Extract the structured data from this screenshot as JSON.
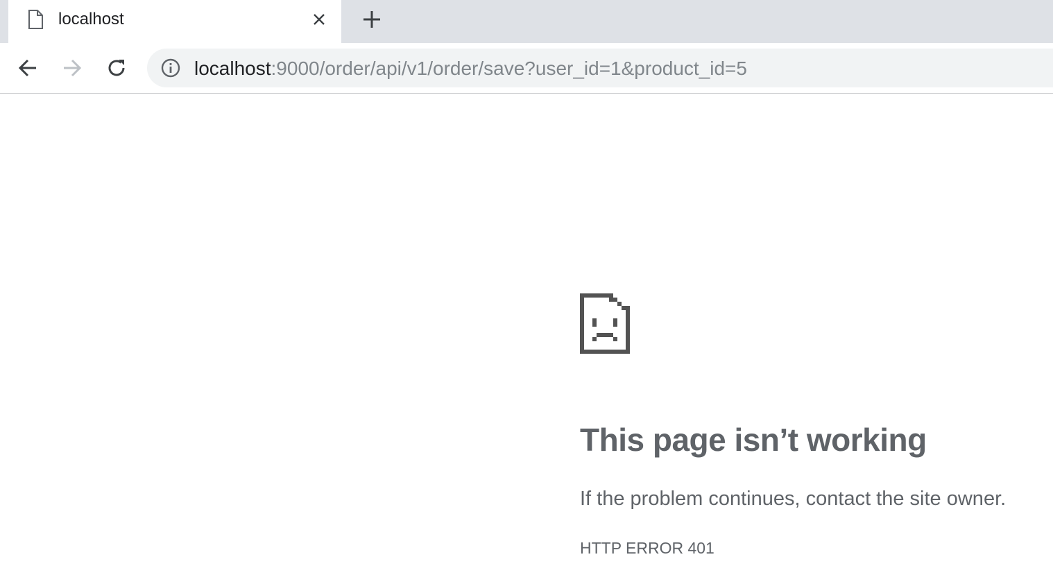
{
  "tab": {
    "title": "localhost",
    "page_icon": "page-icon",
    "close_icon": "close-icon"
  },
  "new_tab_icon": "plus-icon",
  "toolbar": {
    "back_icon": "back-arrow-icon",
    "forward_icon": "forward-arrow-icon",
    "reload_icon": "reload-icon"
  },
  "omnibox": {
    "security_icon": "info-icon",
    "url_host": "localhost",
    "url_rest": ":9000/order/api/v1/order/save?user_id=1&product_id=5"
  },
  "error": {
    "icon": "sad-page-icon",
    "title": "This page isn’t working",
    "description": "If the problem continues, contact the site owner.",
    "code": "HTTP ERROR 401"
  },
  "colors": {
    "tabstrip": "#dee1e6",
    "omnibox": "#f1f3f4",
    "text_dark": "#202124",
    "text_muted": "#5f6368",
    "url_muted": "#80868b"
  }
}
